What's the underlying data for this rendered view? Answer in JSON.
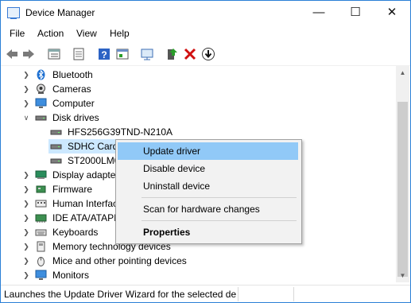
{
  "window": {
    "title": "Device Manager",
    "minimize_glyph": "—",
    "maximize_glyph": "☐",
    "close_glyph": "✕"
  },
  "menu": [
    "File",
    "Action",
    "View",
    "Help"
  ],
  "toolbar": {
    "icons": [
      "back-arrow-icon",
      "forward-arrow-icon",
      "properties-list-icon",
      "show-hidden-icon",
      "help-icon",
      "action-icon",
      "scan-monitor-icon",
      "update-driver-icon",
      "uninstall-x-icon",
      "download-icon"
    ],
    "accent_red": "#d01010",
    "accent_blue": "#2c63c4",
    "accent_green": "#2a9d2a"
  },
  "tree": [
    {
      "label": "Bluetooth",
      "icon": "bluetooth-icon",
      "expanded": false,
      "level": 1
    },
    {
      "label": "Cameras",
      "icon": "camera-icon",
      "expanded": false,
      "level": 1
    },
    {
      "label": "Computer",
      "icon": "computer-icon",
      "expanded": false,
      "level": 1
    },
    {
      "label": "Disk drives",
      "icon": "disk-drive-icon",
      "expanded": true,
      "level": 1
    },
    {
      "label": "HFS256G39TND-N210A",
      "icon": "disk-drive-icon",
      "level": 2
    },
    {
      "label": "SDHC Card",
      "icon": "disk-drive-icon",
      "level": 2,
      "selected": true
    },
    {
      "label": "ST2000LM0",
      "icon": "disk-drive-icon",
      "level": 2
    },
    {
      "label": "Display adapter",
      "icon": "display-adapter-icon",
      "expanded": false,
      "level": 1
    },
    {
      "label": "Firmware",
      "icon": "firmware-icon",
      "expanded": false,
      "level": 1
    },
    {
      "label": "Human Interfac",
      "icon": "hid-icon",
      "expanded": false,
      "level": 1
    },
    {
      "label": "IDE ATA/ATAPI",
      "icon": "ide-controller-icon",
      "expanded": false,
      "level": 1
    },
    {
      "label": "Keyboards",
      "icon": "keyboard-icon",
      "expanded": false,
      "level": 1
    },
    {
      "label": "Memory technology devices",
      "icon": "memory-icon",
      "expanded": false,
      "level": 1
    },
    {
      "label": "Mice and other pointing devices",
      "icon": "mouse-icon",
      "expanded": false,
      "level": 1
    },
    {
      "label": "Monitors",
      "icon": "monitor-icon",
      "expanded": false,
      "level": 1
    }
  ],
  "context_menu": {
    "items": [
      "Update driver",
      "Disable device",
      "Uninstall device",
      "Scan for hardware changes",
      "Properties"
    ],
    "highlight_color": "#91c9f7"
  },
  "status_bar": {
    "text": "Launches the Update Driver Wizard for the selected devi"
  }
}
